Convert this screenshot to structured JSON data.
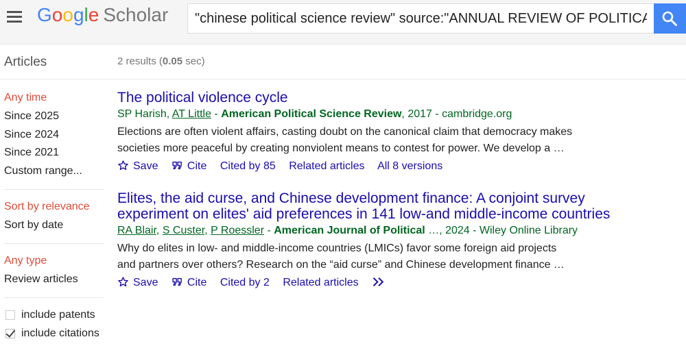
{
  "header": {
    "logo_google": [
      "G",
      "o",
      "o",
      "g",
      "l",
      "e"
    ],
    "logo_scholar": "Scholar",
    "search_value": "\"chinese political science review\" source:\"ANNUAL REVIEW OF POLITICAL"
  },
  "toolbar": {
    "articles_label": "Articles",
    "results_prefix": "2 results (",
    "results_time": "0.05",
    "results_suffix": " sec)"
  },
  "sidebar": {
    "time_heading": "Any time",
    "time_options": [
      "Since 2025",
      "Since 2024",
      "Since 2021",
      "Custom range..."
    ],
    "sort_heading": "Sort by relevance",
    "sort_options": [
      "Sort by date"
    ],
    "type_heading": "Any type",
    "type_options": [
      "Review articles"
    ],
    "include_patents": "include patents",
    "include_citations": "include citations"
  },
  "results": [
    {
      "title": "The political violence cycle",
      "authors_plain1": "SP Harish, ",
      "authors_link1": "AT Little",
      "sep": " - ",
      "venue": "American Political Science Review",
      "year_source": ", 2017 - cambridge.org",
      "snippet_1": "Elections are often violent affairs, casting doubt on the canonical claim that democracy makes",
      "snippet_2": "societies more peaceful by creating nonviolent means to contest for power. We develop a …",
      "save": "Save",
      "cite": "Cite",
      "cited_by": "Cited by 85",
      "related": "Related articles",
      "versions": "All 8 versions"
    },
    {
      "title_1": "Elites, the aid curse, and Chinese development finance: A conjoint survey",
      "title_2": "experiment on elites' aid preferences in 141 low-and middle-income countries",
      "author_1": "RA Blair",
      "author_2": "S Custer",
      "author_3": "P Roessler",
      "comma": ", ",
      "sep": " - ",
      "venue": "American Journal of Political",
      "year_source": " …, 2024 - Wiley Online Library",
      "snippet_1": "Why do elites in low- and middle-income countries (LMICs) favor some foreign aid projects",
      "snippet_2": "and partners over others? Research on the “aid curse” and Chinese development finance …",
      "save": "Save",
      "cite": "Cite",
      "cited_by": "Cited by 2",
      "related": "Related articles",
      "more_icon": "double-chevron-right"
    }
  ]
}
